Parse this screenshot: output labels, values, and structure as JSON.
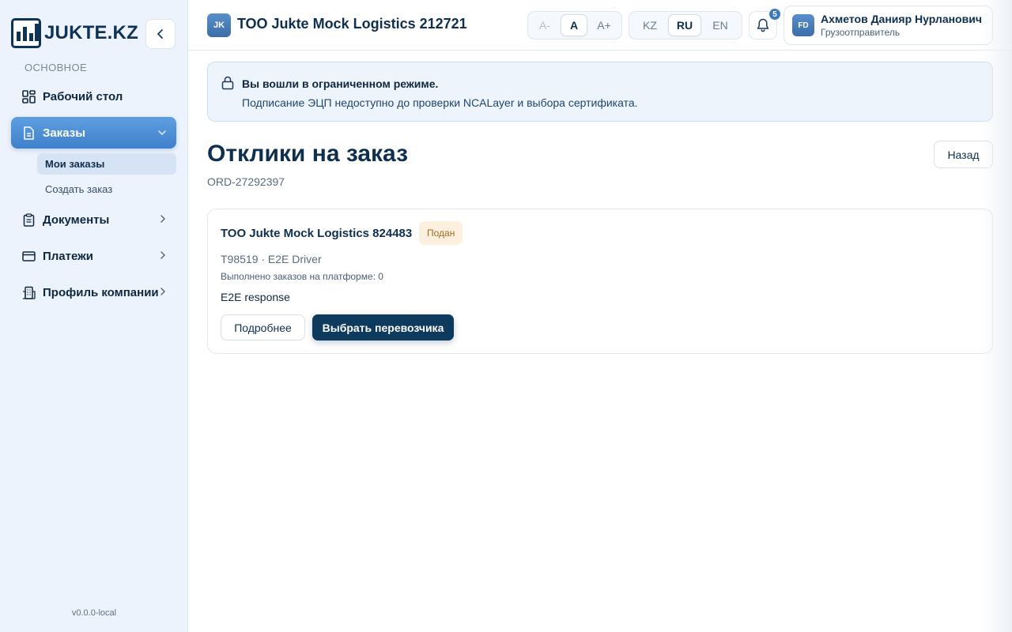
{
  "brand": {
    "name": "JUKTE.KZ"
  },
  "sidebar": {
    "section_label": "ОСНОВНОЕ",
    "items": [
      {
        "label": "Рабочий стол",
        "icon": "dashboard-icon"
      },
      {
        "label": "Заказы",
        "icon": "document-icon",
        "active": true,
        "expanded": true
      },
      {
        "label": "Документы",
        "icon": "clipboard-icon"
      },
      {
        "label": "Платежи",
        "icon": "credit-card-icon"
      },
      {
        "label": "Профиль компании",
        "icon": "building-icon"
      }
    ],
    "subitems": [
      {
        "label": "Мои заказы",
        "active": true
      },
      {
        "label": "Создать заказ"
      }
    ],
    "version": "v0.0.0-local"
  },
  "header": {
    "org_initials": "JK",
    "org_name": "ТОО Jukte Mock Logistics 212721",
    "font_size_options": [
      "A-",
      "A",
      "A+"
    ],
    "font_size_selected": "A",
    "languages": [
      "KZ",
      "RU",
      "EN"
    ],
    "language_selected": "RU",
    "notifications_count": "5",
    "user": {
      "initials": "FD",
      "name": "Ахметов Данияр Нурланович",
      "role": "Грузоотправитель"
    }
  },
  "banner": {
    "title": "Вы вошли в ограниченном режиме.",
    "text": "Подписание ЭЦП недоступно до проверки NCALayer и выбора сертификата."
  },
  "page": {
    "title": "Отклики на заказ",
    "order_code": "ORD-27292397",
    "back_label": "Назад"
  },
  "responses": [
    {
      "company": "ТОО Jukte Mock Logistics 824483",
      "status": "Подан",
      "vehicle_driver": "T98519 · E2E Driver",
      "completed_orders": "Выполнено заказов на платформе: 0",
      "message": "E2E response",
      "details_label": "Подробнее",
      "select_label": "Выбрать перевозчика"
    }
  ],
  "colors": {
    "accent": "#3f80cc",
    "primary_button": "#0e3a5e",
    "status_badge_bg": "#fdf0de",
    "status_badge_text": "#a36a1c"
  }
}
